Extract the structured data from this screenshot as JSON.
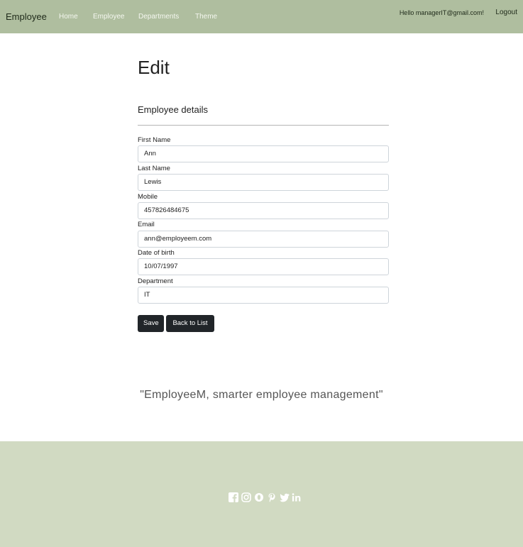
{
  "navbar": {
    "brand": "Employee",
    "links": [
      "Home",
      "Employee",
      "Departments",
      "Theme"
    ],
    "user_greeting": "Hello managerIT@gmail.com!",
    "logout": "Logout"
  },
  "page": {
    "title": "Edit",
    "section_title": "Employee details"
  },
  "form": {
    "fields": [
      {
        "label": "First Name",
        "value": "Ann"
      },
      {
        "label": "Last Name",
        "value": "Lewis"
      },
      {
        "label": "Mobile",
        "value": "457826484675"
      },
      {
        "label": "Email",
        "value": "ann@employeem.com"
      },
      {
        "label": "Date of birth",
        "value": "10/07/1997"
      },
      {
        "label": "Department",
        "value": "IT"
      }
    ],
    "save_label": "Save",
    "back_label": "Back to List"
  },
  "tagline": "\"EmployeeM, smarter employee management\"",
  "footer": {
    "social_icons": [
      "facebook-icon",
      "instagram-icon",
      "opera-icon",
      "pinterest-icon",
      "twitter-icon",
      "linkedin-icon"
    ],
    "bg_color": "#d1dac2"
  },
  "colors": {
    "navbar": "#afbe9f",
    "button": "#212529"
  }
}
